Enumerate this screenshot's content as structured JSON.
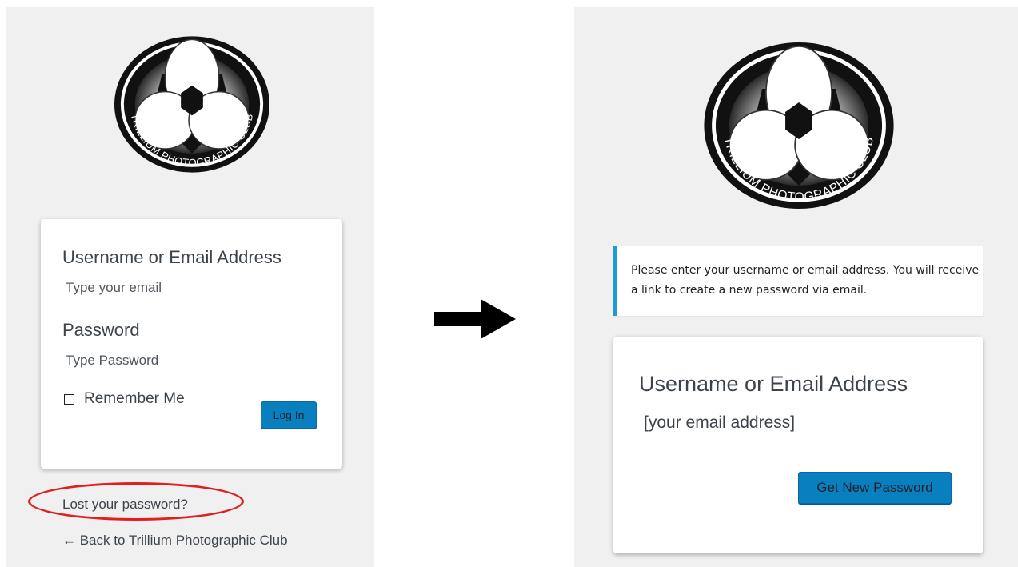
{
  "login_screen": {
    "logo_text": "TRILLIUM PHOTOGRAPHIC CLUB",
    "username_label": "Username or Email Address",
    "username_placeholder": "Type your email",
    "password_label": "Password",
    "password_placeholder": "Type Password",
    "remember_label": "Remember Me",
    "login_button": "Log In",
    "lost_password_link": "Lost your password?",
    "back_link": "← Back to Trillium Photographic Club"
  },
  "reset_screen": {
    "logo_text": "TRILLIUM PHOTOGRAPHIC CLUB",
    "message": "Please enter your username or email address. You will receive a link to create a new password via email.",
    "username_label": "Username or Email Address",
    "username_value": "[your email address]",
    "submit_button": "Get New Password"
  },
  "annotations": {
    "highlight_color": "#e01f1f",
    "arrow_icon": "right-arrow-icon"
  },
  "colors": {
    "button_blue": "#0a7fc0",
    "message_accent": "#1e9ad6",
    "page_background": "#f0f0f1"
  }
}
